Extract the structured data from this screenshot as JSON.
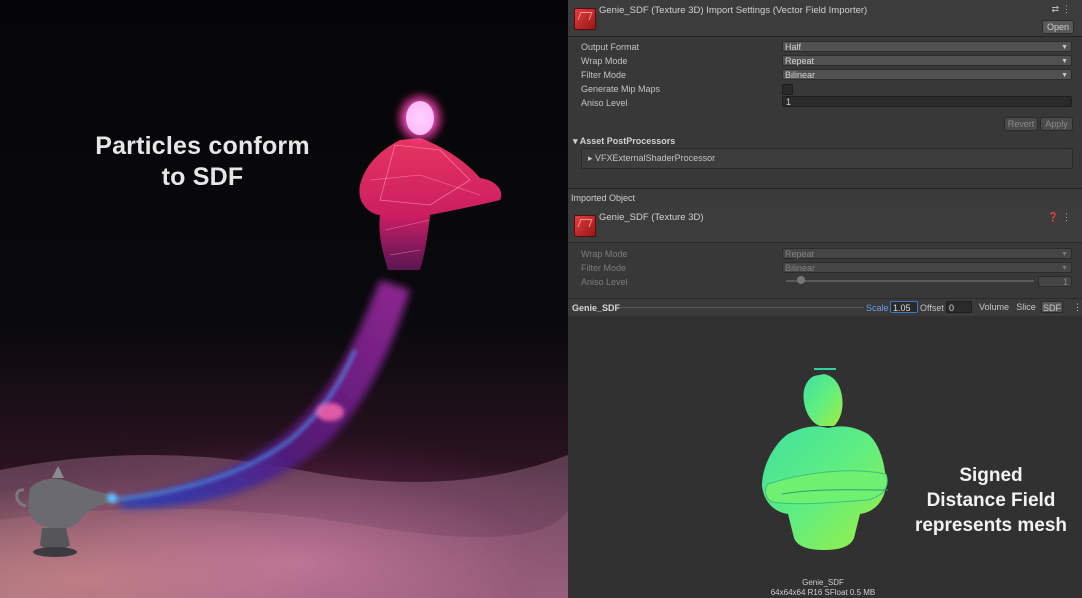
{
  "render": {
    "overlay_text": "Particles conform\nto SDF"
  },
  "inspector": {
    "header": {
      "title": "Genie_SDF (Texture 3D) Import Settings (Vector Field Importer)",
      "open_button": "Open"
    },
    "settings": [
      {
        "label": "Output Format",
        "value": "Half"
      },
      {
        "label": "Wrap Mode",
        "value": "Repeat"
      },
      {
        "label": "Filter Mode",
        "value": "Bilinear"
      },
      {
        "label": "Generate Mip Maps",
        "checked": false
      },
      {
        "label": "Aniso Level",
        "value": "1"
      }
    ],
    "revert_button": "Revert",
    "apply_button": "Apply",
    "asset_postprocessors": {
      "title": "Asset PostProcessors",
      "item": "VFXExternalShaderProcessor"
    },
    "imported_object": {
      "section_title": "Imported Object",
      "title": "Genie_SDF (Texture 3D)",
      "settings": [
        {
          "label": "Wrap Mode",
          "value": "Repeat"
        },
        {
          "label": "Filter Mode",
          "value": "Bilinear"
        },
        {
          "label": "Aniso Level",
          "value": "1",
          "slider_fraction": 0.05
        }
      ]
    },
    "preview": {
      "name": "Genie_SDF",
      "scale_label": "Scale",
      "scale_value": "1.05",
      "offset_label": "Offset",
      "offset_value": "0",
      "modes": [
        "Volume",
        "Slice",
        "SDF"
      ],
      "active_mode": "SDF",
      "caption": "Signed\nDistance Field\nrepresents mesh",
      "info_name": "Genie_SDF",
      "info_details": "64x64x64 R16 SFloat 0.5 MB"
    }
  },
  "icons": {
    "asset": "texture3d-icon",
    "settings": "settings-icon",
    "menu": "kebab-menu-icon",
    "help": "help-icon",
    "foldout": "foldout-arrow-icon"
  },
  "colors": {
    "panel_bg": "#383838",
    "accent_blue": "#6aa0e6",
    "sdf_green": "#60ee80"
  }
}
